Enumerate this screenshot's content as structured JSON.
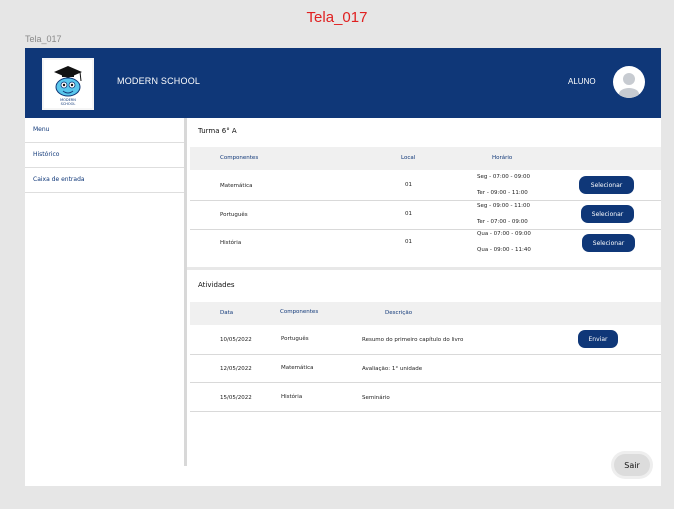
{
  "screen": {
    "title": "Tela_017",
    "label": "Tela_017"
  },
  "header": {
    "brand": "MODERN SCHOOL",
    "role": "ALUNO",
    "logo_text_1": "MODERN",
    "logo_text_2": "SCHOOL"
  },
  "sidebar": {
    "items": [
      {
        "label": "Menu"
      },
      {
        "label": "Histórico"
      },
      {
        "label": "Caixa de entrada"
      }
    ]
  },
  "turma": {
    "title": "Turma 6° A",
    "columns": [
      "Componentes",
      "Local",
      "Horário"
    ],
    "rows": [
      {
        "componente": "Matemática",
        "local": "01",
        "horario1": "Seg - 07:00 - 09:00",
        "horario2": "Ter - 09:00 - 11:00",
        "action": "Selecionar"
      },
      {
        "componente": "Português",
        "local": "01",
        "horario1": "Seg - 09:00 - 11:00",
        "horario2": "Ter - 07:00 - 09:00",
        "action": "Selecionar"
      },
      {
        "componente": "História",
        "local": "01",
        "horario1": "Qua - 07:00 - 09:00",
        "horario2": "Qua - 09:00 - 11:40",
        "action": "Selecionar"
      }
    ]
  },
  "atividades": {
    "title": "Atividades",
    "columns": [
      "Data",
      "Componentes",
      "Descrição"
    ],
    "rows": [
      {
        "data": "10/05/2022",
        "componente": "Português",
        "descricao": "Resumo do primeiro capítulo do livro",
        "action": "Enviar"
      },
      {
        "data": "12/05/2022",
        "componente": "Matemática",
        "descricao": "Avaliação: 1° unidade"
      },
      {
        "data": "15/05/2022",
        "componente": "História",
        "descricao": "Seminário"
      }
    ]
  },
  "footer": {
    "exit_label": "Sair"
  },
  "colors": {
    "primary": "#0f3778",
    "screen_title": "#e02020"
  }
}
